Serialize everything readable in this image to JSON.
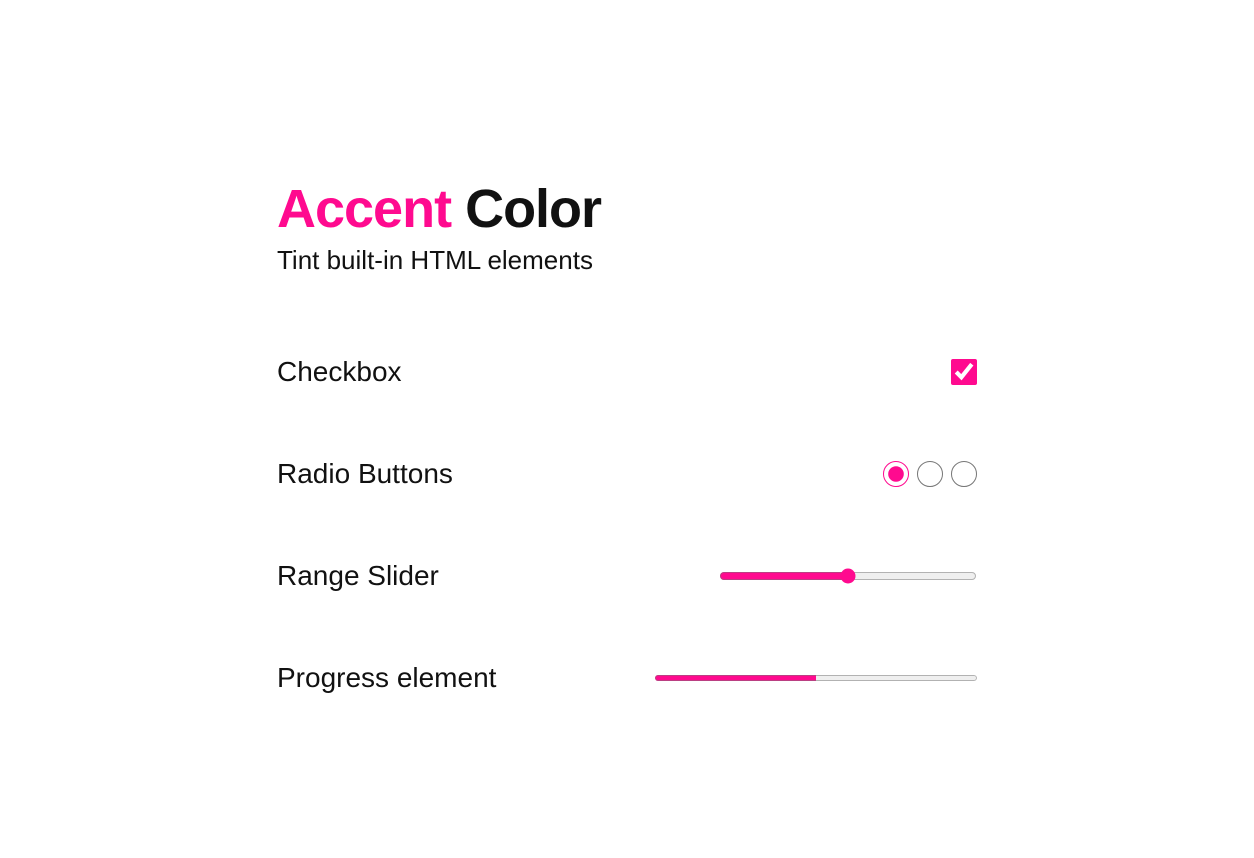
{
  "title": {
    "accent_word": "Accent",
    "rest": " Color"
  },
  "subtitle": "Tint built-in HTML elements",
  "accent_color": "#ff0a8f",
  "rows": {
    "checkbox": {
      "label": "Checkbox",
      "checked": true
    },
    "radio": {
      "label": "Radio Buttons",
      "options": [
        {
          "checked": true
        },
        {
          "checked": false
        },
        {
          "checked": false
        }
      ]
    },
    "range": {
      "label": "Range Slider",
      "min": 0,
      "max": 100,
      "value": 50
    },
    "progress": {
      "label": "Progress element",
      "max": 100,
      "value": 50
    }
  }
}
